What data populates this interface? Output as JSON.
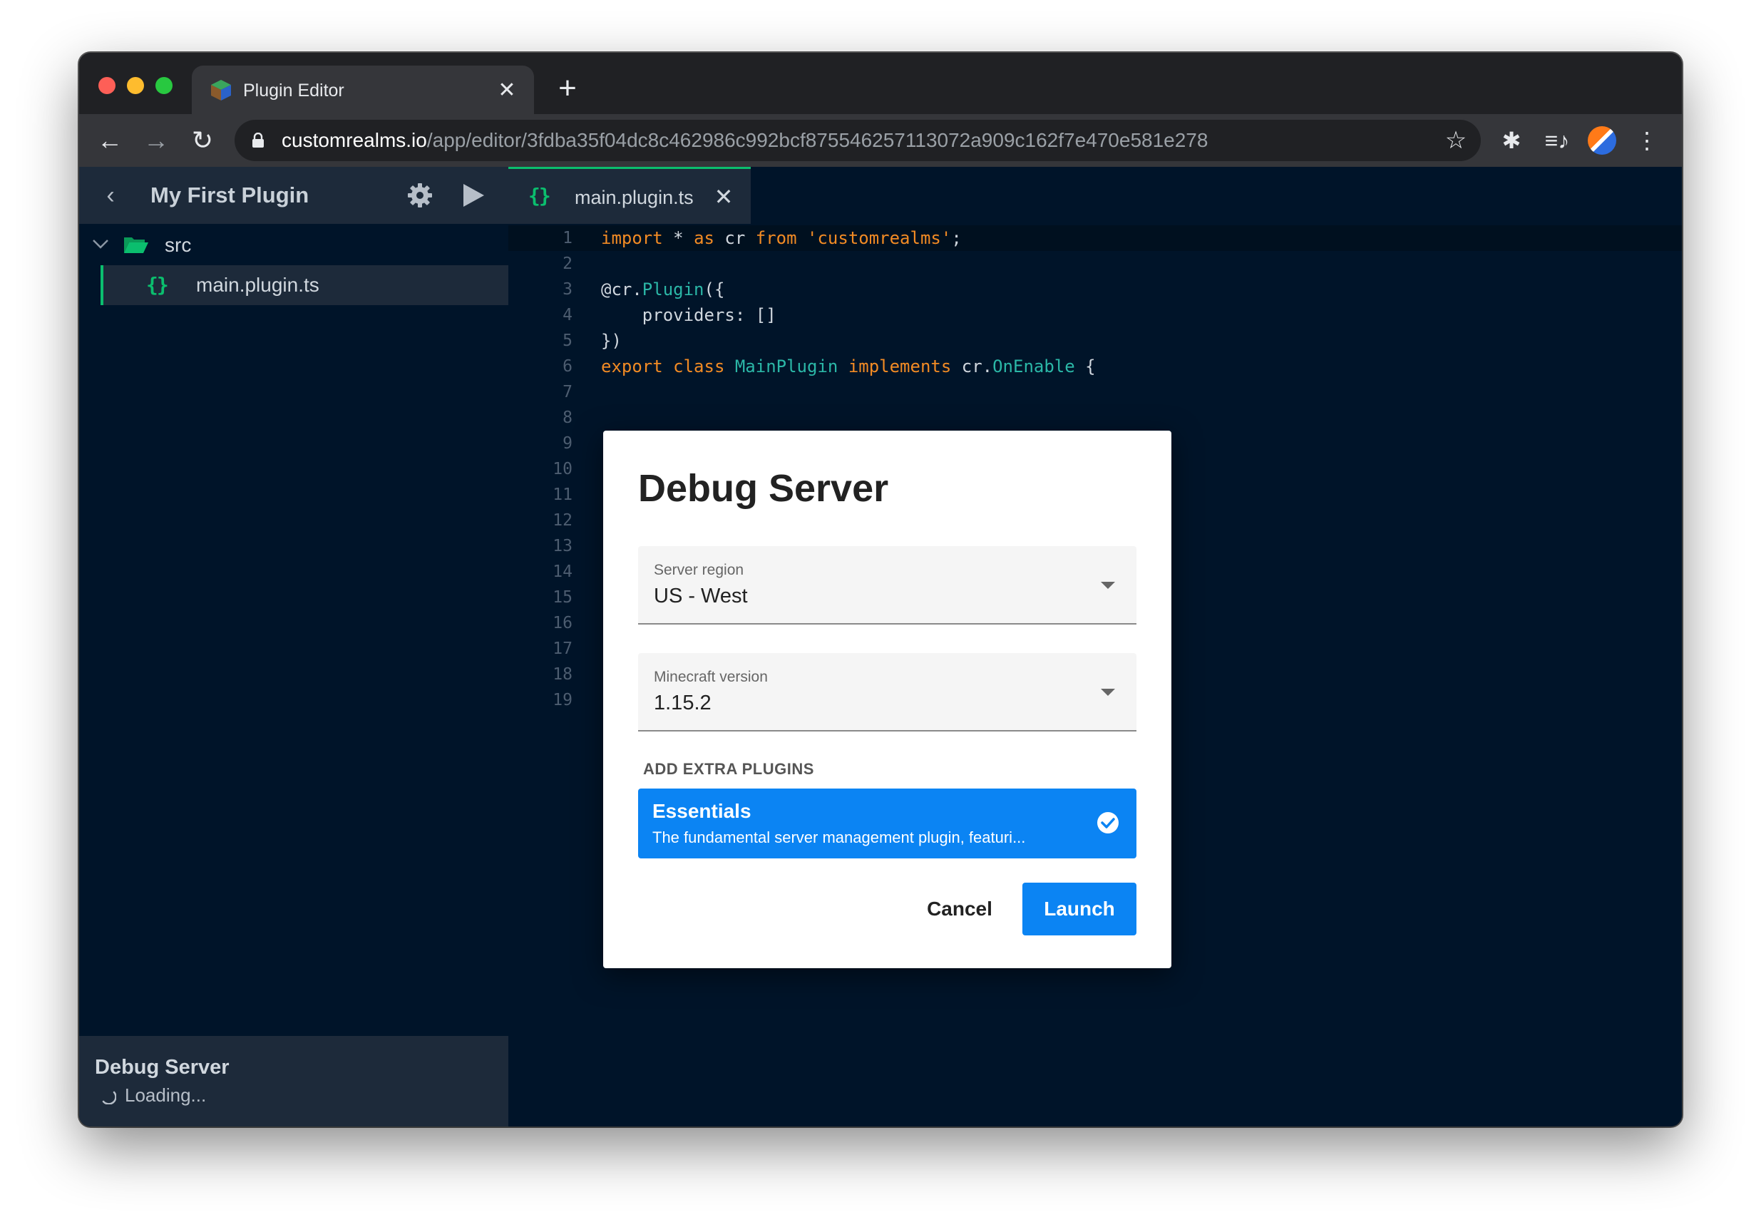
{
  "browser": {
    "tab_title": "Plugin Editor",
    "tab_close": "✕",
    "new_tab": "+",
    "url_host": "customrealms.io",
    "url_path": "/app/editor/3fdba35f04dc8c462986c992bcf875546257113072a909c162f7e470e581e278",
    "icons": {
      "back": "←",
      "forward": "→",
      "reload": "↻",
      "star": "☆",
      "extensions": "✱",
      "media": "≡♪",
      "menu": "⋮"
    }
  },
  "sidebar": {
    "back_icon": "‹",
    "project_name": "My First Plugin",
    "tree": {
      "folder_name": "src",
      "file_icon": "{}",
      "file_name": "main.plugin.ts"
    },
    "footer": {
      "title": "Debug Server",
      "status": "Loading..."
    }
  },
  "editor": {
    "tab_icon": "{}",
    "tab_label": "main.plugin.ts",
    "tab_close": "✕",
    "line_numbers": [
      "1",
      "2",
      "3",
      "4",
      "5",
      "6",
      "7",
      "8",
      "9",
      "10",
      "11",
      "12",
      "13",
      "14",
      "15",
      "16",
      "17",
      "18",
      "19"
    ],
    "code": {
      "l1_import": "import",
      "l1_star": " * ",
      "l1_as": "as",
      "l1_cr": " cr ",
      "l1_from": "from",
      "l1_space": " ",
      "l1_str": "'customrealms'",
      "l1_semi": ";",
      "l3_dec": "@cr.",
      "l3_fn": "Plugin",
      "l3_rest": "({",
      "l4": "    providers: []",
      "l5": "})",
      "l6_export": "export",
      "l6_sp1": " ",
      "l6_class": "class",
      "l6_sp2": " ",
      "l6_name": "MainPlugin",
      "l6_sp3": " ",
      "l6_impl": "implements",
      "l6_cr": " cr.",
      "l6_iface": "OnEnable",
      "l6_brace": " {"
    }
  },
  "modal": {
    "title": "Debug Server",
    "region_label": "Server region",
    "region_value": "US - West",
    "version_label": "Minecraft version",
    "version_value": "1.15.2",
    "extra_plugins_label": "ADD EXTRA PLUGINS",
    "plugin_name": "Essentials",
    "plugin_description": "The fundamental server management plugin, featuri...",
    "cancel_label": "Cancel",
    "launch_label": "Launch"
  },
  "colors": {
    "accent_blue": "#0b84f3",
    "accent_green": "#0bbe6e",
    "editor_bg": "#001429",
    "panel_bg": "#1d2a3a",
    "keyword": "#f28b24",
    "identifier": "#2bb7a7"
  }
}
